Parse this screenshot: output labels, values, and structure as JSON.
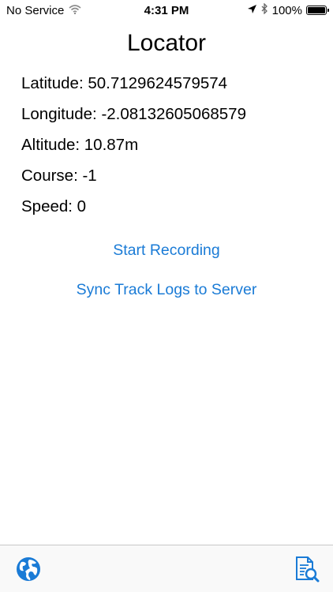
{
  "status_bar": {
    "carrier": "No Service",
    "time": "4:31 PM",
    "battery": "100%"
  },
  "title": "Locator",
  "readouts": [
    {
      "label": "Latitude: 50.7129624579574"
    },
    {
      "label": "Longitude: -2.08132605068579"
    },
    {
      "label": "Altitude: 10.87m"
    },
    {
      "label": "Course: -1"
    },
    {
      "label": "Speed: 0"
    }
  ],
  "actions": {
    "start_recording": "Start Recording",
    "sync": "Sync Track Logs to Server"
  },
  "tab_bar": {
    "items": [
      {
        "icon": "globe-icon"
      },
      {
        "icon": "log-search-icon"
      }
    ]
  },
  "colors": {
    "accent": "#1a7bd6",
    "text": "#000000",
    "background": "#ffffff"
  }
}
